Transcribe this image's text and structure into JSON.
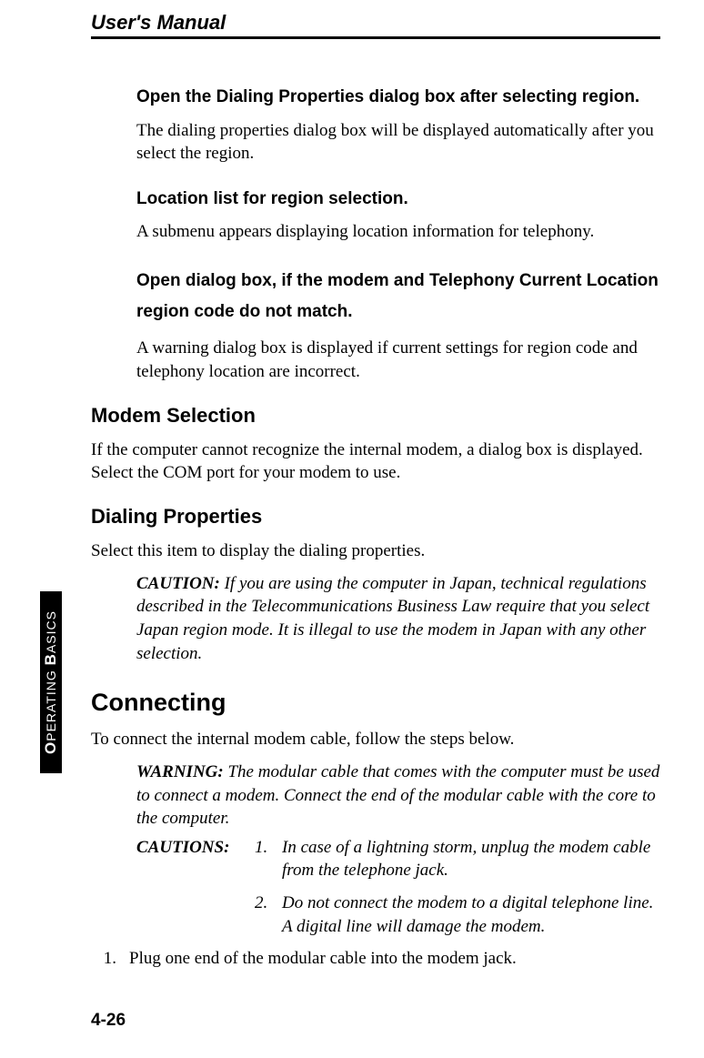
{
  "header": {
    "title": "User's Manual"
  },
  "side_tab": "OPERATING BASICS",
  "page_number": "4-26",
  "sections": {
    "s1_h": "Open the Dialing Properties dialog box after selecting region.",
    "s1_p": "The dialing properties dialog box will be displayed automatically after you select the region.",
    "s2_h": "Location list for region selection.",
    "s2_p": "A submenu appears displaying location information for telephony.",
    "s3_h": "Open dialog box, if the modem and Telephony Current Location region code do not match.",
    "s3_p": "A warning dialog box is displayed if current settings for region code and telephony location are incorrect.",
    "modem_h": "Modem Selection",
    "modem_p": "If the computer cannot recognize the internal modem, a dialog box is displayed. Select the COM port for your modem to use.",
    "dial_h": "Dialing Properties",
    "dial_p": "Select this item to display the dialing properties.",
    "caution_label": "CAUTION:",
    "caution_text": " If you are using the computer in Japan, technical regulations described in the Telecommunications Business Law require that you select Japan region mode. It is illegal to use the modem in Japan with any other selection.",
    "connect_h": "Connecting",
    "connect_p": "To connect the internal modem cable, follow the steps below.",
    "warn_label": "WARNING:",
    "warn_text": " The modular cable that comes with the computer must be used to connect a modem. Connect the end of the modular cable with the core to the computer.",
    "cautions_label": "CAUTIONS:",
    "cautions": [
      {
        "n": "1.",
        "t": "In case of a lightning storm, unplug the modem cable from the telephone jack."
      },
      {
        "n": "2.",
        "t": "Do not connect the modem to a digital telephone line. A digital line will damage the modem."
      }
    ],
    "step1_n": "1.",
    "step1_t": "Plug one end of the modular cable into the modem jack."
  }
}
